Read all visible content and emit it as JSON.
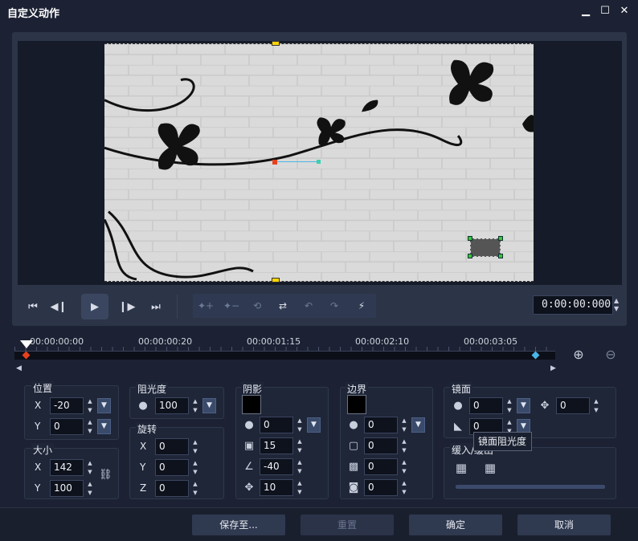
{
  "window": {
    "title": "自定义动作",
    "minimize": "▁",
    "maximize": "☐",
    "close": "✕"
  },
  "playback": {
    "timecode": "0:00:00:000"
  },
  "timeline": {
    "labels": [
      "00:00:00:00",
      "00:00:00:20",
      "00:00:01:15",
      "00:00:02:10",
      "00:00:03:05"
    ]
  },
  "position": {
    "title": "位置",
    "x_label": "X",
    "y_label": "Y",
    "x": "-20",
    "y": "0"
  },
  "size": {
    "title": "大小",
    "x_label": "X",
    "y_label": "Y",
    "x": "142",
    "y": "100"
  },
  "opacity": {
    "title": "阻光度",
    "value": "100"
  },
  "rotation": {
    "title": "旋转",
    "x_label": "X",
    "y_label": "Y",
    "z_label": "Z",
    "x": "0",
    "y": "0",
    "z": "0"
  },
  "shadow": {
    "title": "阴影",
    "opacity": "0",
    "blur": "15",
    "angle": "-40",
    "distance": "10"
  },
  "border": {
    "title": "边界",
    "opacity": "0",
    "width": "0",
    "blur": "0",
    "fill": "0"
  },
  "mirror": {
    "title": "镜面",
    "opacity": "0",
    "distance": "0",
    "fade": "0"
  },
  "fade": {
    "title": "缓入/缓出"
  },
  "tooltip": {
    "text": "镜面阻光度"
  },
  "buttons": {
    "save_to": "保存至...",
    "reset": "重置",
    "ok": "确定",
    "cancel": "取消"
  },
  "colors": {
    "accent_yellow": "#ffd400",
    "keyframe_blue": "#4ab6e8",
    "handle_red": "#e8401c"
  }
}
